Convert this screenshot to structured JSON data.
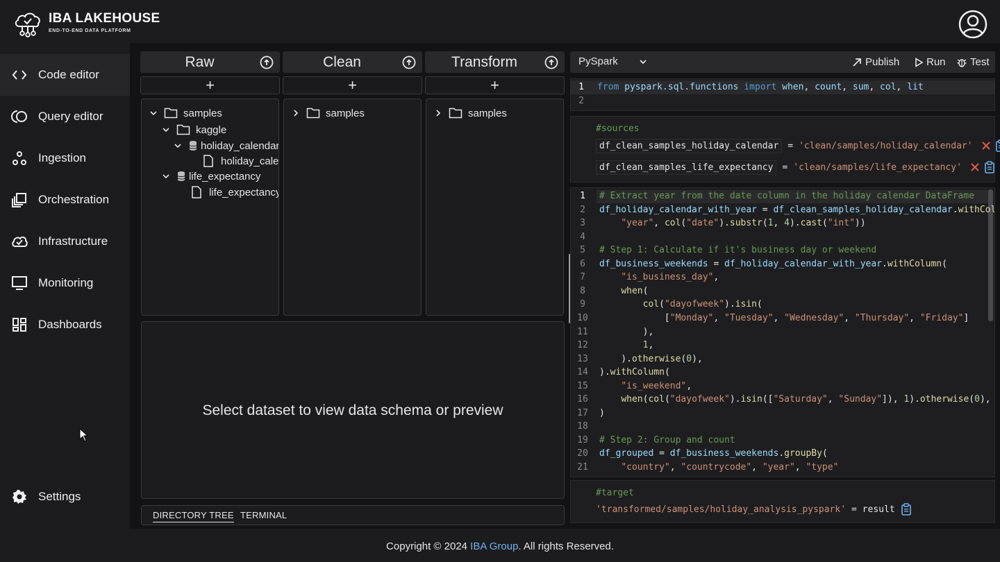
{
  "brand": {
    "title": "IBA LAKEHOUSE",
    "subtitle": "END-TO-END DATA PLATFORM"
  },
  "sidebar": {
    "items": [
      {
        "label": "Code editor",
        "icon": "code-icon",
        "active": true
      },
      {
        "label": "Query editor",
        "icon": "query-icon"
      },
      {
        "label": "Ingestion",
        "icon": "ingestion-icon"
      },
      {
        "label": "Orchestration",
        "icon": "orchestration-icon"
      },
      {
        "label": "Infrastructure",
        "icon": "cloud-icon"
      },
      {
        "label": "Monitoring",
        "icon": "monitor-icon"
      },
      {
        "label": "Dashboards",
        "icon": "dashboard-icon"
      }
    ],
    "settings_label": "Settings"
  },
  "columns": {
    "raw": {
      "title": "Raw"
    },
    "clean": {
      "title": "Clean"
    },
    "transform": {
      "title": "Transform"
    },
    "add_label": "+"
  },
  "tree": {
    "raw": [
      "samples",
      "kaggle",
      "holiday_calendar",
      "holiday_calendar",
      "life_expectancy",
      "life_expectancy"
    ],
    "clean": [
      "samples"
    ],
    "transform": [
      "samples"
    ]
  },
  "preview": {
    "message": "Select dataset to view data schema or preview"
  },
  "bottom_tabs": {
    "directory": "DIRECTORY TREE",
    "terminal": "TERMINAL"
  },
  "toolbar": {
    "language": "PySpark",
    "publish": "Publish",
    "run": "Run",
    "test": "Test"
  },
  "imports": {
    "line1_num": "1",
    "line2_num": "2"
  },
  "sources": {
    "header": "#sources",
    "items": [
      {
        "name": "df_clean_samples_holiday_calendar",
        "path": "'clean/samples/holiday_calendar'"
      },
      {
        "name": "df_clean_samples_life_expectancy",
        "path": "'clean/samples/life_expectancy'"
      }
    ]
  },
  "code_lines": [
    "# Extract year from the date column in the holiday calendar DataFrame",
    "df_holiday_calendar_with_year = df_clean_samples_holiday_calendar.withColumn(",
    "    \"year\", col(\"date\").substr(1, 4).cast(\"int\"))",
    "",
    "# Step 1: Calculate if it's business day or weekend",
    "df_business_weekends = df_holiday_calendar_with_year.withColumn(",
    "    \"is_business_day\",",
    "    when(",
    "        col(\"dayofweek\").isin(",
    "            [\"Monday\", \"Tuesday\", \"Wednesday\", \"Thursday\", \"Friday\"]",
    "        ),",
    "        1,",
    "    ).otherwise(0),",
    ").withColumn(",
    "    \"is_weekend\",",
    "    when(col(\"dayofweek\").isin([\"Saturday\", \"Sunday\"]), 1).otherwise(0),",
    ")",
    "",
    "# Step 2: Group and count",
    "df_grouped = df_business_weekends.groupBy(",
    "    \"country\", \"countrycode\", \"year\", \"type\""
  ],
  "target": {
    "header": "#target",
    "path": "'transformed/samples/holiday_analysis_pyspark'",
    "assign": "= result"
  },
  "footer": {
    "prefix": "Copyright © 2024 ",
    "link": "IBA Group",
    "suffix": ". All rights Reserved."
  }
}
